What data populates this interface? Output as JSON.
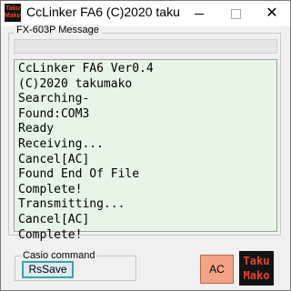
{
  "window": {
    "title": "CcLinker FA6 (C)2020 taku...",
    "icon_text": [
      "Taku",
      "Mako"
    ],
    "minimize_label": "—",
    "maximize_label": "☐",
    "close_label": "✕"
  },
  "group": {
    "label": "FX-603P Message"
  },
  "log": {
    "lines": [
      "CcLinker FA6 Ver0.4",
      "(C)2020 takumako",
      "Searching-",
      "Found:COM3",
      "Ready",
      "Receiving...",
      "Cancel[AC]",
      "Found End Of File",
      "Complete!",
      "Transmitting...",
      "Cancel[AC]",
      "Complete!"
    ]
  },
  "command": {
    "label": "Casio command",
    "rssave_label": "RsSave"
  },
  "ac_button": {
    "label": "AC"
  },
  "logo": {
    "lines": [
      "Taku",
      "Mako"
    ]
  },
  "colors": {
    "log_background": "#e6f5e6",
    "ac_button": "#f4a483",
    "rssave_border": "#39a3a8",
    "logo_text": "#e8432c"
  }
}
